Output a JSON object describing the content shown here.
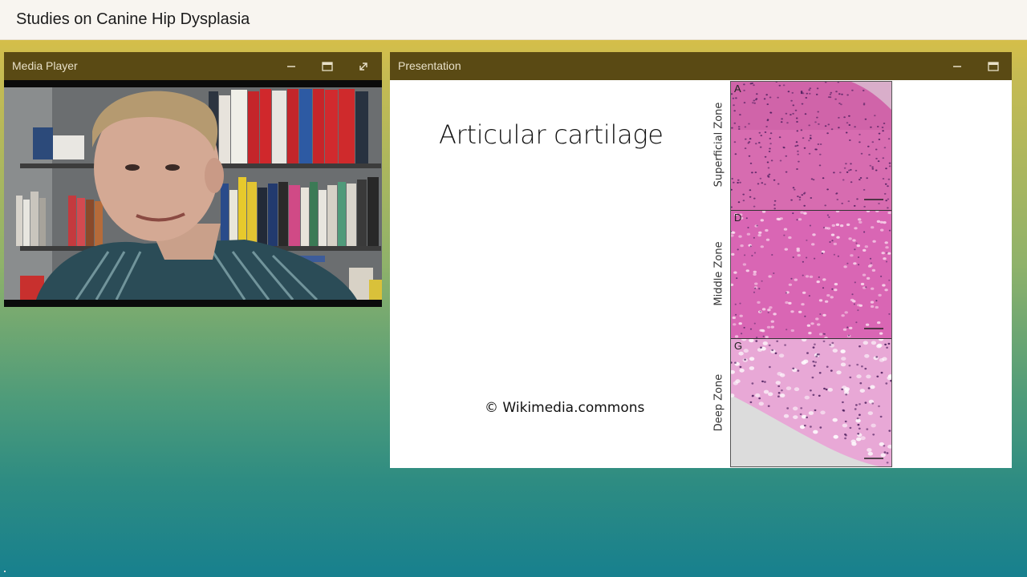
{
  "app": {
    "title": "Studies on Canine Hip Dysplasia"
  },
  "media_player": {
    "title": "Media Player",
    "controls": {
      "minimize": "minimize-icon",
      "maximize": "maximize-icon",
      "fullscreen": "expand-icon"
    }
  },
  "presentation": {
    "title": "Presentation",
    "controls": {
      "minimize": "minimize-icon",
      "maximize": "maximize-icon"
    },
    "slide": {
      "heading": "Articular cartilage",
      "credit": "© Wikimedia.commons",
      "figure": {
        "panels": [
          {
            "letter": "A",
            "zone": "Superficial Zone"
          },
          {
            "letter": "D",
            "zone": "Middle Zone"
          },
          {
            "letter": "G",
            "zone": "Deep Zone"
          }
        ]
      }
    }
  },
  "colors": {
    "header_bar": "#5a4a14",
    "top_bar": "#f8f5f0",
    "stain_pink": "#d65aa8"
  }
}
